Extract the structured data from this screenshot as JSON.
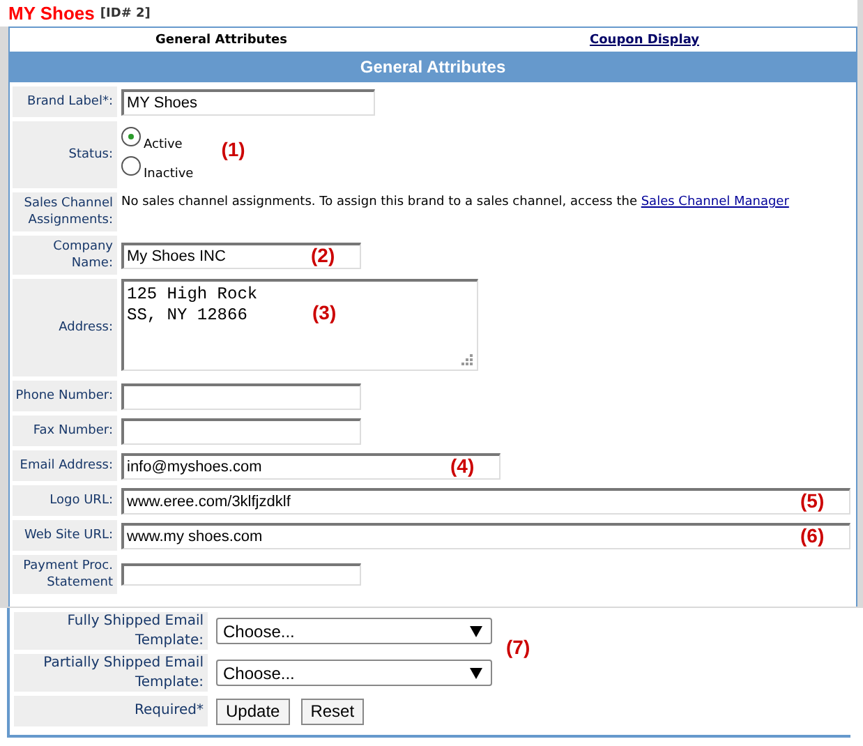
{
  "title": "MY Shoes",
  "id_label": "[ID# 2]",
  "tabs": [
    {
      "label": "General Attributes",
      "selected": true
    },
    {
      "label": "Coupon Display",
      "selected": false
    }
  ],
  "section_header": "General Attributes",
  "fields": [
    {
      "kind": "text",
      "label": "Brand Label*:",
      "value": "MY Shoes"
    },
    {
      "kind": "radio",
      "label": "Status:",
      "options": [
        {
          "label": "Active",
          "selected": true
        },
        {
          "label": "Inactive",
          "selected": false
        }
      ],
      "annotation": "(1)"
    },
    {
      "kind": "info",
      "label": "Sales Channel Assignments:",
      "text": "No sales channel assignments. To assign this brand to a sales channel, access the ",
      "link": "Sales Channel Manager"
    },
    {
      "kind": "text",
      "label": "Company Name:",
      "value": "My Shoes INC",
      "annotation": "(2)"
    },
    {
      "kind": "textarea",
      "label": "Address:",
      "lines": [
        "125 High Rock",
        "SS, NY 12866"
      ],
      "annotation": "(3)"
    },
    {
      "kind": "text",
      "label": "Phone Number:"
    },
    {
      "kind": "text",
      "label": "Fax Number:"
    },
    {
      "kind": "text",
      "label": "Email Address:",
      "value": "info@myshoes.com",
      "annotation": "(4)"
    },
    {
      "kind": "text",
      "label": "Logo URL:",
      "value": "www.eree.com/3klfjzdklf",
      "annotation": "(5)"
    },
    {
      "kind": "text",
      "label": "Web Site URL:",
      "value": "www.my shoes.com",
      "annotation": "(6)"
    },
    {
      "kind": "text",
      "label": "Payment Proc. Statement"
    }
  ],
  "lower_fields": [
    {
      "kind": "select",
      "label": "Fully Shipped Email Template:",
      "value": "Choose..."
    },
    {
      "kind": "select",
      "label": "Partially Shipped Email Template:",
      "value": "Choose..."
    },
    {
      "kind": "buttons",
      "label": "Required*",
      "buttons": [
        "Update",
        "Reset"
      ]
    }
  ],
  "lower_annotation": "(7)"
}
